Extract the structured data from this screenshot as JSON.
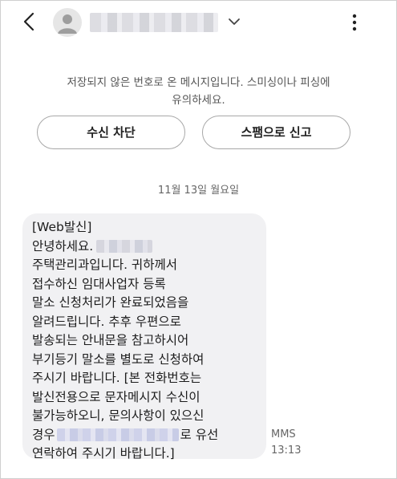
{
  "header": {
    "back_icon": "chevron-left-icon",
    "avatar_icon": "person-icon",
    "contact_name_hidden": true,
    "dropdown_icon": "chevron-down-icon",
    "more_icon": "more-vertical-icon"
  },
  "notice": {
    "line1": "저장되지 않은 번호로 온 메시지입니다. 스미싱이나 피싱에",
    "line2": "유의하세요."
  },
  "actions": {
    "block_label": "수신 차단",
    "spam_label": "스팸으로 신고"
  },
  "date_divider": "11월 13일 월요일",
  "message": {
    "lines": [
      "[Web발신]",
      "안녕하세요.",
      "주택관리과입니다. 귀하께서",
      "접수하신 임대사업자 등록",
      "말소 신청처리가 완료되었음을",
      "알려드립니다. 추후 우편으로",
      "발송되는 안내문을 참고하시어",
      "부기등기 말소를 별도로 신청하여",
      "주시기 바랍니다. [본 전화번호는",
      "발신전용으로 문자메시지 수신이",
      "불가능하오니, 문의사항이 있으신",
      "경우",
      "로 유선",
      "연락하여 주시기 바랍니다.]"
    ],
    "type": "MMS",
    "time": "13:13"
  }
}
